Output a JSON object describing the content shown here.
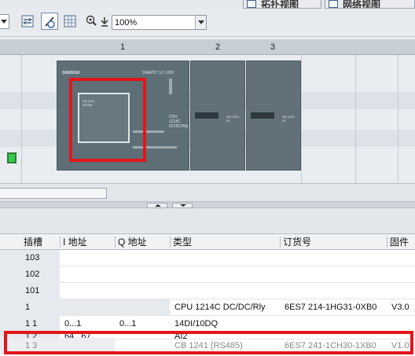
{
  "view_tabs": {
    "topology": "拓扑视图",
    "network": "网络视图"
  },
  "toolbar": {
    "zoom_value": "100%",
    "icons": [
      "device-swap-icon",
      "pointer-icon",
      "grid-icon",
      "zoom-icon",
      "download-icon"
    ]
  },
  "rack": {
    "slots": [
      "1",
      "2",
      "3"
    ],
    "cpu": {
      "brand": "SIEMENS",
      "series": "SIMATIC S7-1200",
      "model_line1": "CPU 1214C",
      "model_line2": "DC/DC/Rly",
      "board_line1": "CB 1241",
      "board_line2": "RS485"
    },
    "signal_modules": [
      {
        "label1": "SM 1221",
        "label2": "DI"
      },
      {
        "label1": "SM 1221",
        "label2": "DI"
      }
    ]
  },
  "table": {
    "headers": {
      "slot": "插槽",
      "i_address": "I 地址",
      "q_address": "Q 地址",
      "type": "类型",
      "order_no": "订货号",
      "firmware": "固件"
    },
    "rows": [
      {
        "slot": "103",
        "i_address": "",
        "q_address": "",
        "type": "",
        "order_no": "",
        "firmware": ""
      },
      {
        "slot": "102",
        "i_address": "",
        "q_address": "",
        "type": "",
        "order_no": "",
        "firmware": ""
      },
      {
        "slot": "101",
        "i_address": "",
        "q_address": "",
        "type": "",
        "order_no": "",
        "firmware": ""
      },
      {
        "slot": "1",
        "i_address": "",
        "q_address": "",
        "type": "CPU 1214C DC/DC/Rly",
        "order_no": "6ES7 214-1HG31-0XB0",
        "firmware": "V3.0"
      },
      {
        "slot": "1 1",
        "i_address": "0...1",
        "q_address": "0...1",
        "type": "14DI/10DQ",
        "order_no": "",
        "firmware": ""
      },
      {
        "slot": "1 2",
        "i_address": "64...67",
        "q_address": "",
        "type": "AI2",
        "order_no": "",
        "firmware": ""
      },
      {
        "slot": "1 3",
        "i_address": "",
        "q_address": "",
        "type": "CB 1241 (RS485)",
        "order_no": "6ES7 241-1CH30-1XB0",
        "firmware": "V1.0"
      }
    ]
  },
  "colors": {
    "highlight": "#e3151b",
    "module": "#5e6e77",
    "led": "#35c94d"
  }
}
